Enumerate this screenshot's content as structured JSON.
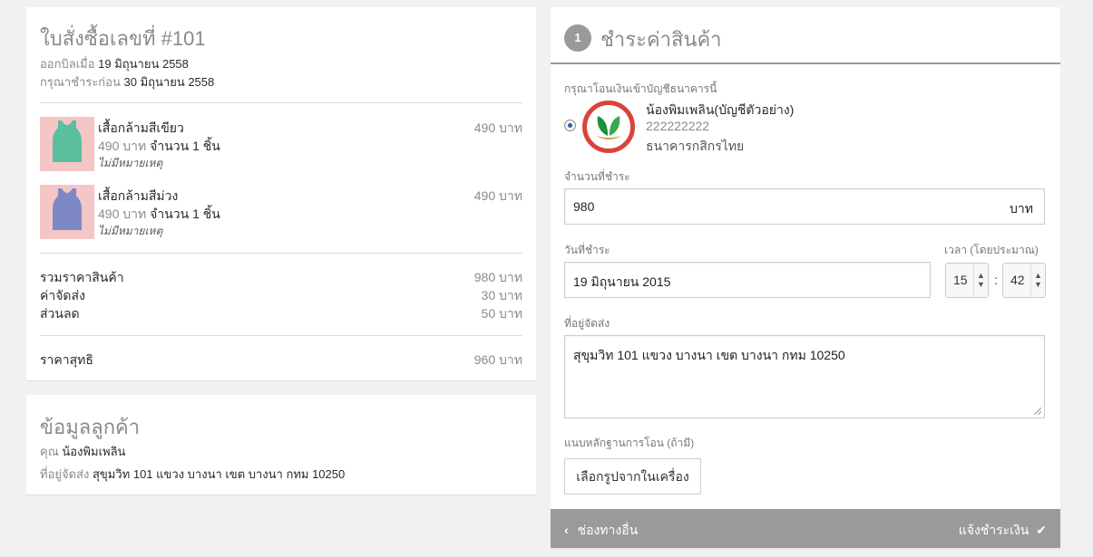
{
  "order": {
    "title": "ใบสั่งซื้อเลขที่ #101",
    "issued_label": "ออกบิลเมื่อ",
    "issued_date": "19 มิถุนายน 2558",
    "due_label": "กรุณาชำระก่อน",
    "due_date": "30 มิถุนายน 2558",
    "items": [
      {
        "name": "เสื้อกล้ามสีเขียว",
        "unit_price": "490 บาท",
        "qty": "จำนวน 1 ชิ้น",
        "note": "ไม่มีหมายเหตุ",
        "price": "490 บาท",
        "color": "#5bbf9f"
      },
      {
        "name": "เสื้อกล้ามสีม่วง",
        "unit_price": "490 บาท",
        "qty": "จำนวน 1 ชิ้น",
        "note": "ไม่มีหมายเหตุ",
        "price": "490 บาท",
        "color": "#7f88c6"
      }
    ],
    "subtotal_label": "รวมราคาสินค้า",
    "subtotal": "980 บาท",
    "shipping_label": "ค่าจัดส่ง",
    "shipping": "30 บาท",
    "discount_label": "ส่วนลด",
    "discount": "50 บาท",
    "net_label": "ราคาสุทธิ",
    "net": "960 บาท"
  },
  "customer": {
    "title": "ข้อมูลลูกค้า",
    "name_prefix": "คุณ",
    "name": "น้องพิมเพลิน",
    "address_label": "ที่อยู่จัดส่ง",
    "address": "สุขุมวิท 101 แขวง บางนา เขต บางนา กทม 10250"
  },
  "payment": {
    "step": "1",
    "title": "ชำระค่าสินค้า",
    "bank_instruction": "กรุณาโอนเงินเข้าบัญชีธนาคารนี้",
    "bank_account_name": "น้องพิมเพลิน(บัญชีตัวอย่าง)",
    "bank_account_number": "222222222",
    "bank_name": "ธนาคารกสิกรไทย",
    "amount_label": "จำนวนที่ชำระ",
    "amount_value": "980",
    "amount_unit": "บาท",
    "date_label": "วันที่ชำระ",
    "date_value": "19 มิถุนายน 2015",
    "time_label": "เวลา (โดยประมาณ)",
    "hour": "15",
    "minute": "42",
    "address_label": "ที่อยู่จัดส่ง",
    "address_value": "สุขุมวิท 101 แขวง บางนา เขต บางนา กทม 10250",
    "attach_label": "แนบหลักฐานการโอน (ถ้ามี)",
    "attach_button": "เลือกรูปจากในเครื่อง",
    "back_label": "ช่องทางอื่น",
    "submit_label": "แจ้งชำระเงิน",
    "colors": {
      "header_gray": "#9a9a9a",
      "bank_red": "#d9433b",
      "bank_green": "#1f8f3a"
    }
  }
}
